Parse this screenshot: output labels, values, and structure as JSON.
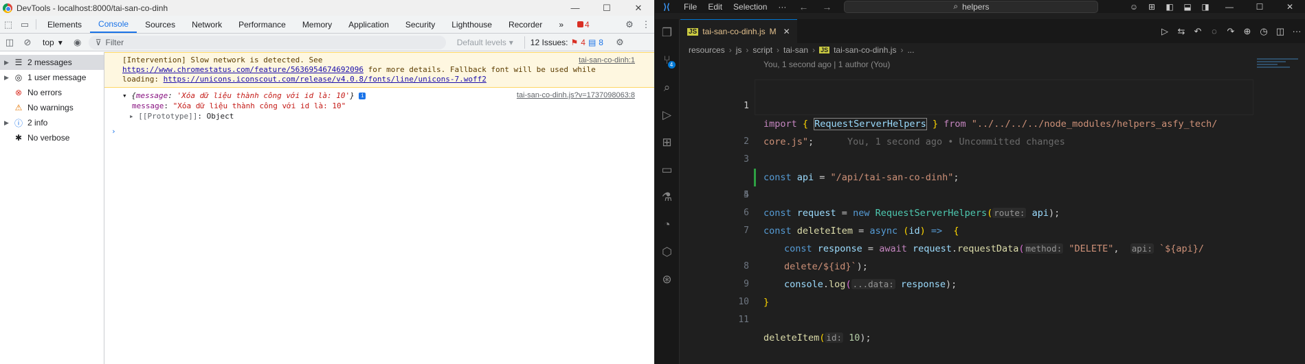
{
  "devtools": {
    "window_title": "DevTools - localhost:8000/tai-san-co-dinh",
    "tabs": [
      "Elements",
      "Console",
      "Sources",
      "Network",
      "Performance",
      "Memory",
      "Application",
      "Security",
      "Lighthouse",
      "Recorder"
    ],
    "active_tab": "Console",
    "more_tabs": "»",
    "error_badge": "4",
    "context": "top",
    "filter_placeholder": "Filter",
    "levels": "Default levels",
    "issues_label": "12 Issues:",
    "issues_errors": "4",
    "issues_info": "8",
    "sidebar": [
      {
        "label": "2 messages",
        "icon": "list-icon",
        "expandable": true
      },
      {
        "label": "1 user message",
        "icon": "user-icon",
        "expandable": true
      },
      {
        "label": "No errors",
        "icon": "error-icon",
        "expandable": false
      },
      {
        "label": "No warnings",
        "icon": "warning-icon",
        "expandable": false
      },
      {
        "label": "2 info",
        "icon": "info-icon",
        "expandable": true
      },
      {
        "label": "No verbose",
        "icon": "bug-icon",
        "expandable": false
      }
    ],
    "warning": {
      "text1": "[Intervention] Slow network is detected. See",
      "link1": "https://www.chromestatus.com/feature/5636954674692096",
      "text2": " for more details. Fallback font will be used while",
      "text3": "loading: ",
      "link2": "https://unicons.iconscout.com/release/v4.0.8/fonts/line/unicons-7.woff2",
      "source": "tai-san-co-dinh:1"
    },
    "log": {
      "head_open": "{",
      "head_key": "message",
      "head_colon": ": ",
      "head_value": "'Xóa dữ liệu thành công với id là: 10'",
      "head_close": "}",
      "info_mark": "i",
      "source": "tai-san-co-dinh.js?v=1737098063:8",
      "prop_key": "message",
      "prop_colon": ": ",
      "prop_value": "\"Xóa dữ liệu thành công với id là: 10\"",
      "proto_key": "[[Prototype]]",
      "proto_colon": ": ",
      "proto_value": "Object"
    },
    "prompt": "›"
  },
  "vscode": {
    "menu": [
      "File",
      "Edit",
      "Selection",
      "···"
    ],
    "search": "helpers",
    "tab": {
      "name": "tai-san-co-dinh.js",
      "modified": "M",
      "icon": "JS"
    },
    "scm_badge": "4",
    "breadcrumbs": [
      "resources",
      "js",
      "script",
      "tai-san",
      "tai-san-co-dinh.js",
      "..."
    ],
    "codelens": "You, 1 second ago | 1 author (You)",
    "lines": {
      "l1_kw": "import",
      "l1_brace_open": " { ",
      "l1_cls": "RequestServerHelpers",
      "l1_brace_close": " } ",
      "l1_from": "from",
      "l1_str": " \"../../../../node_modules/helpers_asfy_tech/",
      "l1b_str": "core.js\"",
      "l1b_semi": ";",
      "l1b_ghost": "      You, 1 second ago • Uncommitted changes",
      "l3_kw": "const",
      "l3_var": " api",
      "l3_eq": " = ",
      "l3_str": "\"/api/tai-san-co-dinh\"",
      "l3_semi": ";",
      "l4_kw": "const",
      "l4_var": " request",
      "l4_eq": " = ",
      "l4_new": "new",
      "l4_cls": " RequestServerHelpers",
      "l4_open": "(",
      "l4_hint": "route:",
      "l4_arg": " api",
      "l4_close": ");",
      "l6_kw": "const",
      "l6_fn": " deleteItem",
      "l6_eq": " = ",
      "l6_async": "async",
      "l6_params_open": " (",
      "l6_param": "id",
      "l6_params_close": ") ",
      "l6_arrow": "=>",
      "l6_brace": "  {",
      "l7_kw": "const",
      "l7_var": " response",
      "l7_eq": " = ",
      "l7_await": "await",
      "l7_obj": " request",
      "l7_dot": ".",
      "l7_fn": "requestData",
      "l7_open": "(",
      "l7_hint1": "method:",
      "l7_str1": " \"DELETE\"",
      "l7_comma": ",  ",
      "l7_hint2": "api:",
      "l7_tpl": " `${api}/",
      "l7b_tpl": "delete/${id}`",
      "l7b_close": ");",
      "l8_obj": "console",
      "l8_dot": ".",
      "l8_fn": "log",
      "l8_open": "(",
      "l8_hint": "...data:",
      "l8_arg": " response",
      "l8_close": ");",
      "l9": "}",
      "l11_fn": "deleteItem",
      "l11_open": "(",
      "l11_hint": "id:",
      "l11_num": " 10",
      "l11_close": ");"
    },
    "line_numbers": [
      "1",
      "",
      "2",
      "3",
      "4",
      "5",
      "6",
      "7",
      "",
      "8",
      "9",
      "10",
      "11"
    ]
  }
}
